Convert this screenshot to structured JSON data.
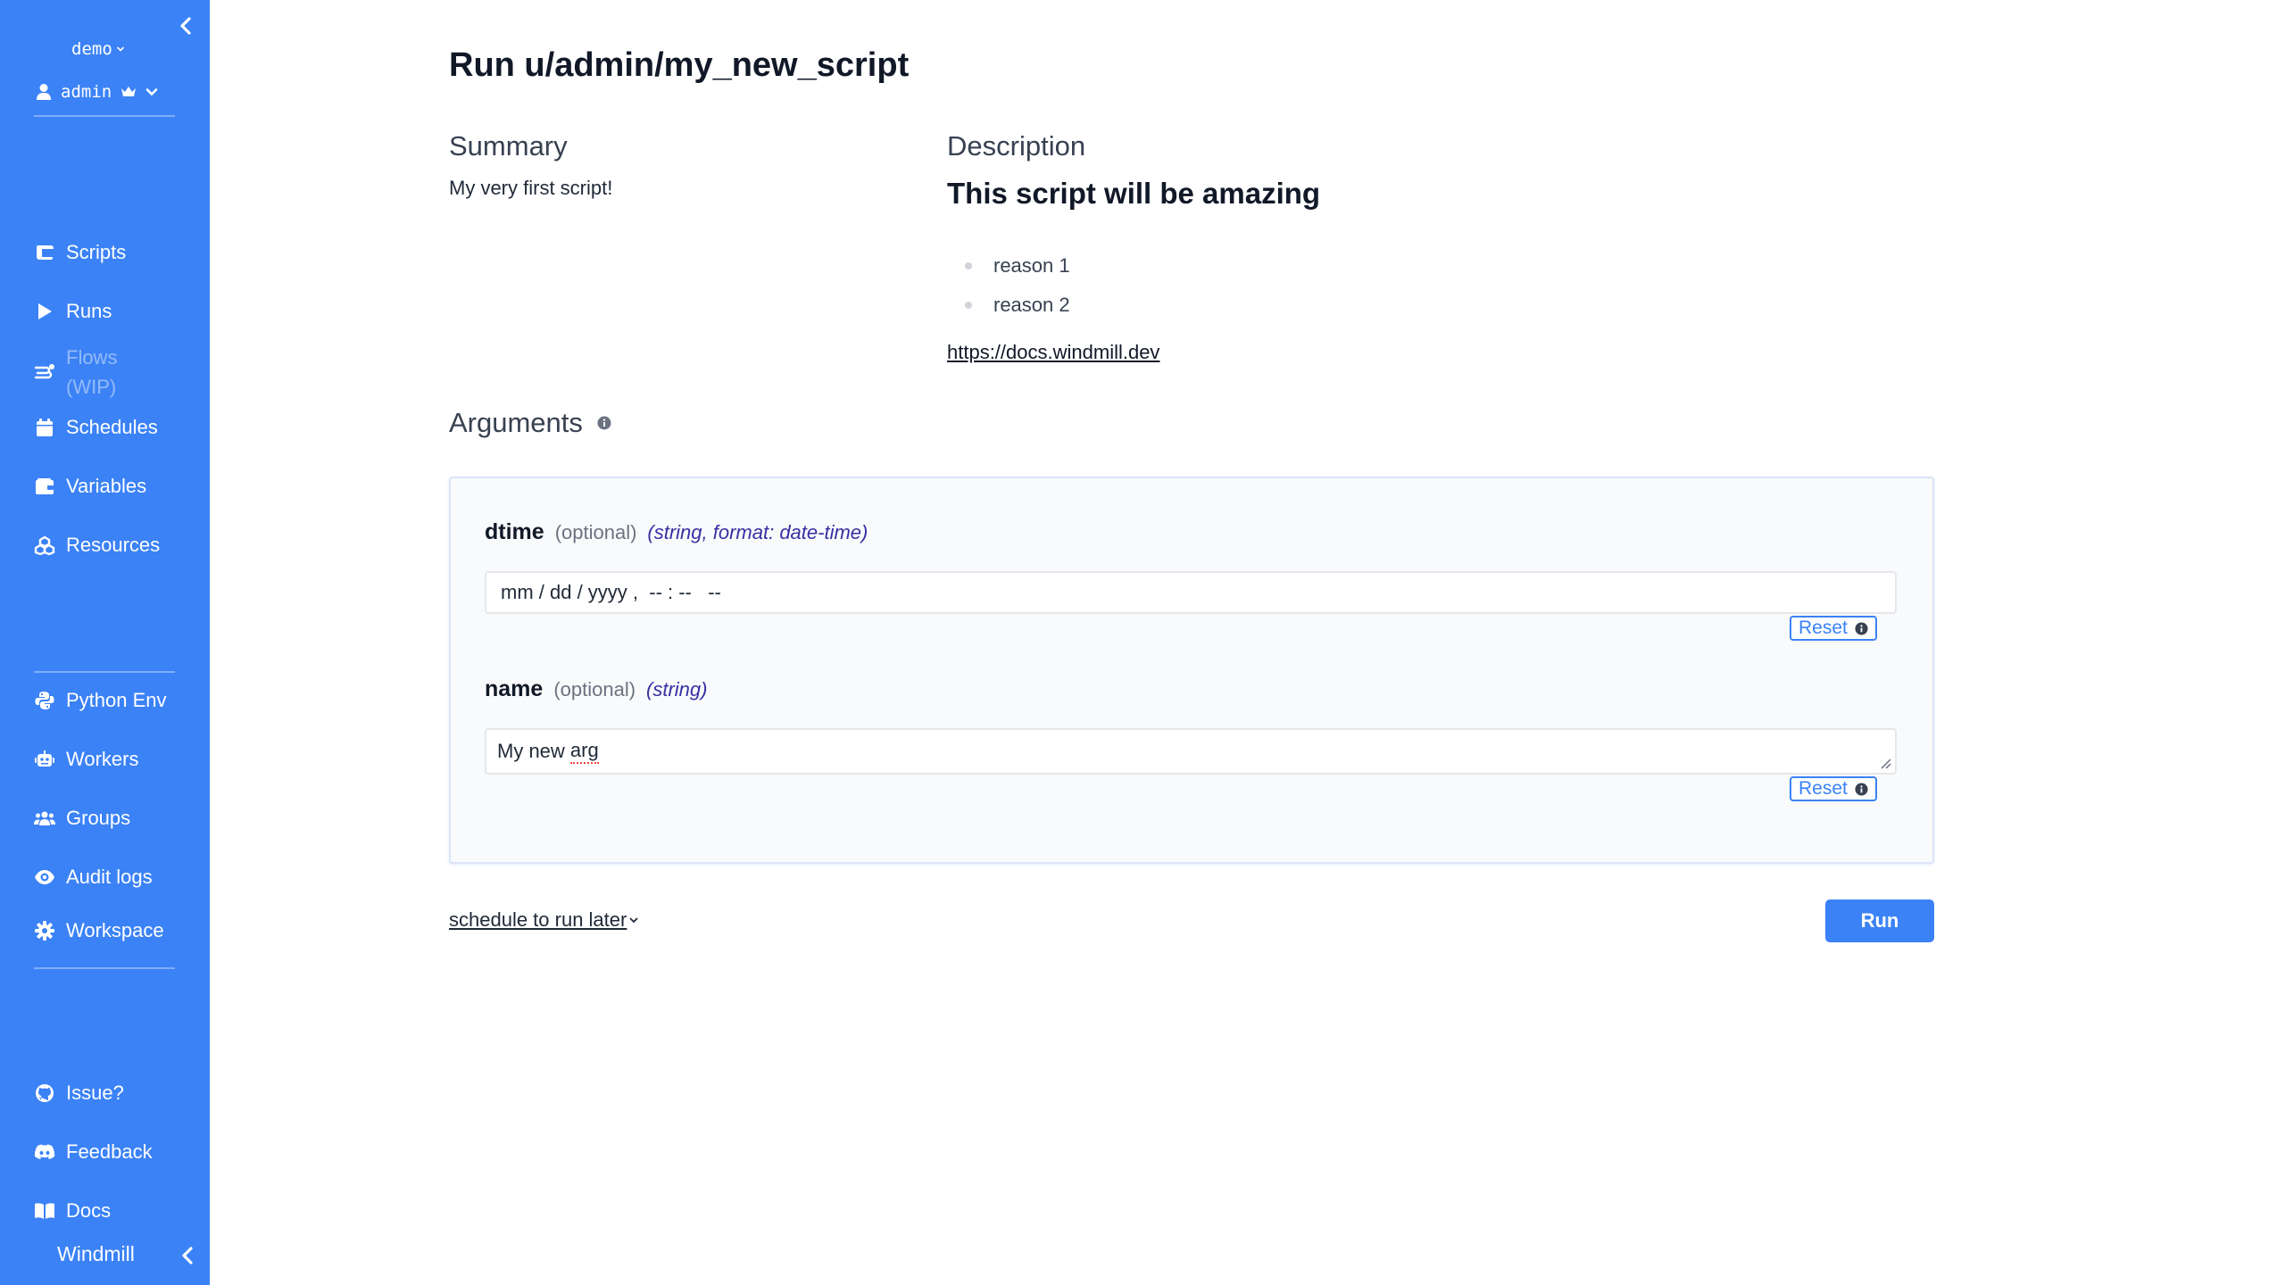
{
  "sidebar": {
    "workspace": "demo",
    "user": "admin",
    "items": [
      {
        "label": "Scripts",
        "icon": "scripts-icon"
      },
      {
        "label": "Runs",
        "icon": "play-icon"
      },
      {
        "label": "Flows",
        "sub": "(WIP)",
        "icon": "flows-icon",
        "disabled": true
      },
      {
        "label": "Schedules",
        "icon": "calendar-icon"
      },
      {
        "label": "Variables",
        "icon": "wallet-icon"
      },
      {
        "label": "Resources",
        "icon": "cubes-icon"
      },
      {
        "label": "Python Env",
        "icon": "python-icon"
      },
      {
        "label": "Workers",
        "icon": "robot-icon"
      },
      {
        "label": "Groups",
        "icon": "users-icon"
      },
      {
        "label": "Audit logs",
        "icon": "eye-icon"
      },
      {
        "label": "Workspace",
        "icon": "gear-icon"
      },
      {
        "label": "Issue?",
        "icon": "github-icon"
      },
      {
        "label": "Feedback",
        "icon": "discord-icon"
      },
      {
        "label": "Docs",
        "icon": "book-icon"
      }
    ],
    "brand": "Windmill"
  },
  "main": {
    "title": "Run u/admin/my_new_script",
    "summary_heading": "Summary",
    "summary_text": "My very first script!",
    "description_heading": "Description",
    "description_title": "This script will be amazing",
    "description_items": [
      "reason 1",
      "reason 2"
    ],
    "description_link": "https://docs.windmill.dev",
    "arguments_heading": "Arguments",
    "args": [
      {
        "name": "dtime",
        "optional": "(optional)",
        "type": "(string, format: date-time)",
        "placeholder": "mm / dd / yyyy ,  -- : --   --",
        "reset": "Reset"
      },
      {
        "name": "name",
        "optional": "(optional)",
        "type": "(string)",
        "value_start": "My new ",
        "value_end": "arg",
        "reset": "Reset"
      }
    ],
    "schedule_link": "schedule to run later",
    "run_button": "Run"
  },
  "colors": {
    "sidebar": "#3b82f6",
    "accent": "#3b82f6",
    "type_hint": "#3730a3"
  }
}
